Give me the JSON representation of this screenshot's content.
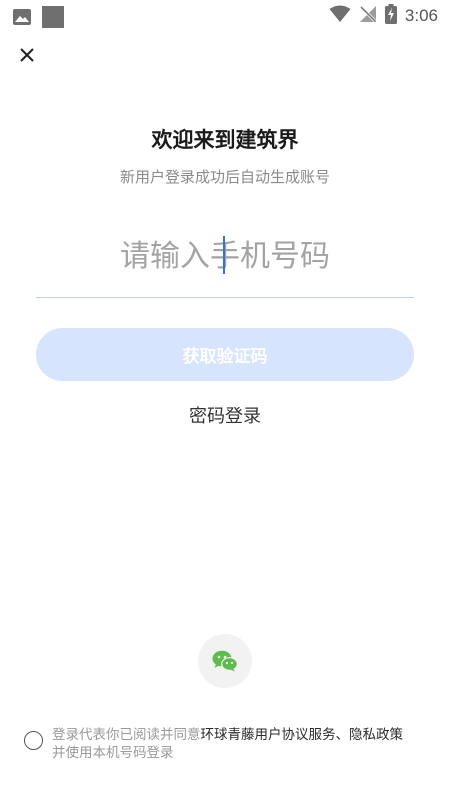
{
  "status_bar": {
    "time": "3:06"
  },
  "title": "欢迎来到建筑界",
  "subtitle": "新用户登录成功后自动生成账号",
  "phone": {
    "placeholder": "请输入手机号码",
    "value": ""
  },
  "get_code_label": "获取验证码",
  "password_login_label": "密码登录",
  "agreement": {
    "prefix": "登录代表你已阅读并同意",
    "link_agreement": "环球青藤用户协议服务",
    "separator": "、",
    "link_privacy": "隐私政策",
    "suffix": "并使用本机号码登录"
  },
  "colors": {
    "accent_disabled": "#d6e4fd",
    "underline": "#bcd0ea",
    "wechat_green": "#5ebc4f"
  }
}
